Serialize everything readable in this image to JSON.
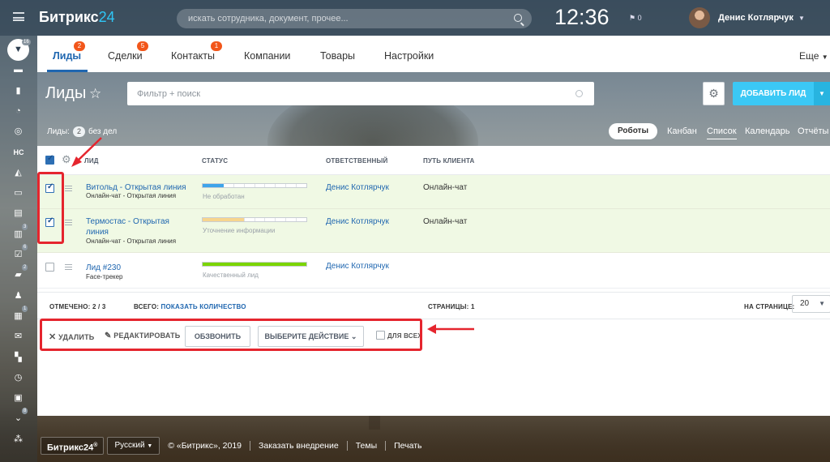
{
  "topbar": {
    "logo_text": "Битрикс",
    "logo_num": "24",
    "search_placeholder": "искать сотрудника, документ, прочее...",
    "clock": "12:36",
    "flag_count": "0",
    "user_name": "Денис Котлярчук"
  },
  "sidebar": {
    "items": [
      {
        "icon": "filter-icon",
        "badge": "16"
      },
      {
        "icon": "inbox-icon",
        "badge": ""
      },
      {
        "icon": "chart-icon",
        "badge": ""
      },
      {
        "icon": "crm-icon",
        "badge": ""
      },
      {
        "icon": "target-icon",
        "badge": ""
      },
      {
        "icon": "hc-icon",
        "label": "НС",
        "badge": ""
      },
      {
        "icon": "sales-icon",
        "badge": ""
      },
      {
        "icon": "window-icon",
        "badge": ""
      },
      {
        "icon": "store-icon",
        "badge": ""
      },
      {
        "icon": "doc-icon",
        "badge": "3"
      },
      {
        "icon": "tasks-icon",
        "badge": "6"
      },
      {
        "icon": "chat-icon",
        "badge": "2"
      },
      {
        "icon": "group-icon",
        "badge": ""
      },
      {
        "icon": "calendar-icon",
        "badge": "1"
      },
      {
        "icon": "mail-icon",
        "badge": ""
      },
      {
        "icon": "apps-icon",
        "badge": ""
      },
      {
        "icon": "clock-icon",
        "badge": ""
      },
      {
        "icon": "drive-icon",
        "badge": ""
      },
      {
        "icon": "more-icon",
        "badge": "8"
      },
      {
        "icon": "network-icon",
        "badge": ""
      }
    ]
  },
  "tabs": [
    {
      "label": "Лиды",
      "badge": "2",
      "active": true
    },
    {
      "label": "Сделки",
      "badge": "5"
    },
    {
      "label": "Контакты",
      "badge": "1"
    },
    {
      "label": "Компании",
      "badge": ""
    },
    {
      "label": "Товары",
      "badge": ""
    },
    {
      "label": "Настройки",
      "badge": ""
    }
  ],
  "tab_more": "Еще",
  "page_title": "Лиды",
  "filter_placeholder": "Фильтр + поиск",
  "add_button": "ДОБАВИТЬ ЛИД",
  "counter": {
    "prefix": "Лиды:",
    "count": "2",
    "suffix": "без дел"
  },
  "robots": "Роботы",
  "views": [
    "Канбан",
    "Список",
    "Календарь",
    "Отчёты"
  ],
  "grid": {
    "headers": {
      "lead": "ЛИД",
      "status": "СТАТУС",
      "responsible": "ОТВЕТСТВЕННЫЙ",
      "path": "ПУТЬ КЛИЕНТА"
    },
    "rows": [
      {
        "name": "Витольд - Открытая линия",
        "source": "Онлайн-чат - Открытая линия",
        "status": "Не обработан",
        "progress": 0.2,
        "color": "#3ea4ea",
        "responsible": "Денис Котлярчук",
        "path": "Онлайн-чат",
        "checked": true
      },
      {
        "name_1": "Термостас - Открытая",
        "name_2": "линия",
        "source": "Онлайн-чат - Открытая линия",
        "status": "Уточнение информации",
        "progress": 0.4,
        "color": "#f7d58e",
        "responsible": "Денис Котлярчук",
        "path": "Онлайн-чат",
        "checked": true
      },
      {
        "name": "Лид #230",
        "source": "Face-трекер",
        "status": "Качественный лид",
        "progress": 1.0,
        "color": "#7bd500",
        "responsible": "Денис Котлярчук",
        "path": "",
        "checked": false
      }
    ],
    "footer": {
      "selected_label": "ОТМЕЧЕНО:",
      "selected_value": "2 / 3",
      "total_label": "ВСЕГО:",
      "total_link": "ПОКАЗАТЬ КОЛИЧЕСТВО",
      "pages_label": "СТРАНИЦЫ:",
      "pages_value": "1",
      "perpage_label": "НА СТРАНИЦЕ:",
      "perpage_value": "20"
    }
  },
  "actions": {
    "delete": "УДАЛИТЬ",
    "edit": "РЕДАКТИРОВАТЬ",
    "call": "ОБЗВОНИТЬ",
    "choose": "ВЫБЕРИТЕ ДЕЙСТВИЕ",
    "for_all": "ДЛЯ ВСЕХ"
  },
  "footer": {
    "logo": "Битрикс24",
    "logo_mark": "®",
    "lang": "Русский",
    "copyright": "© «Битрикс», 2019",
    "order": "Заказать внедрение",
    "themes": "Темы",
    "print": "Печать"
  },
  "colors": {
    "accent": "#2067b0",
    "add_button": "#3bc8f5",
    "highlight": "#e5252e",
    "badge": "#f2561a"
  }
}
